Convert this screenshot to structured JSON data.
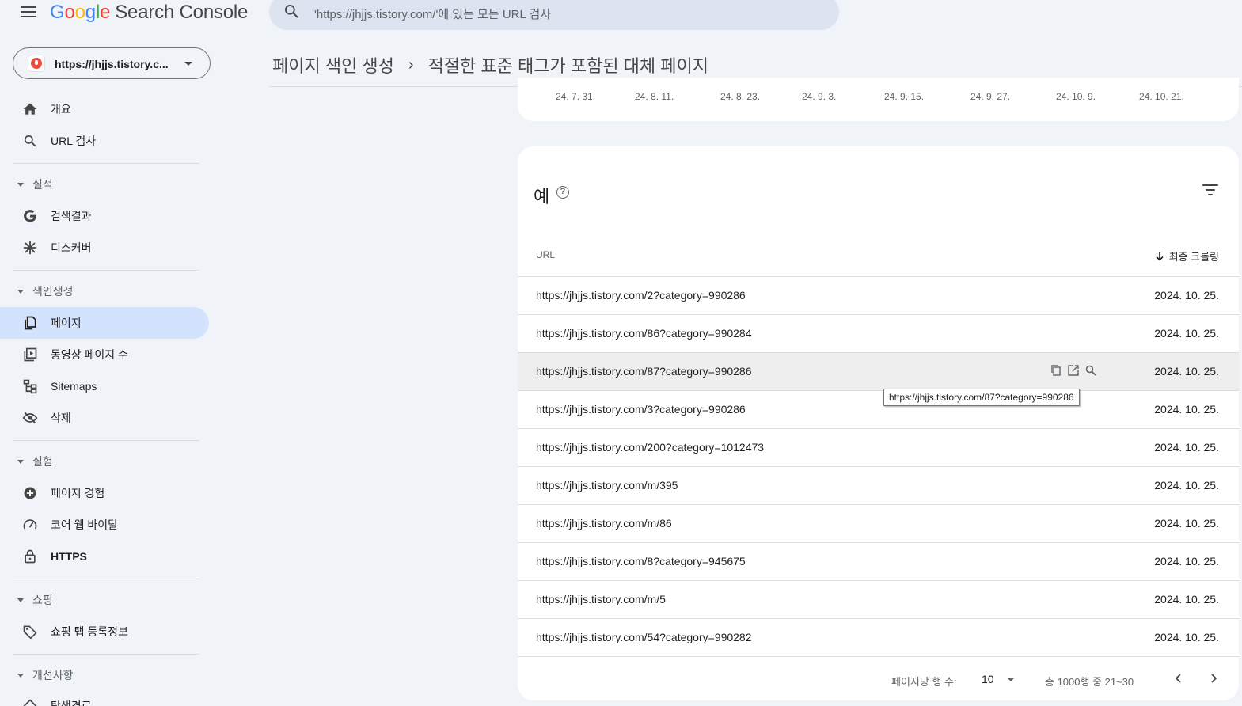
{
  "app": {
    "logo_google": [
      "G",
      "o",
      "o",
      "g",
      "l",
      "e"
    ],
    "logo_product": "Search Console"
  },
  "search": {
    "placeholder": "'https://jhjjs.tistory.com/'에 있는 모든 URL 검사"
  },
  "property": {
    "label": "https://jhjjs.tistory.c..."
  },
  "breadcrumb": {
    "parent": "페이지 색인 생성",
    "separator": "›",
    "current": "적절한 표준 태그가 포함된 대체 페이지"
  },
  "sidebar": {
    "top": [
      {
        "label": "개요",
        "icon": "home-icon"
      },
      {
        "label": "URL 검사",
        "icon": "search-icon"
      }
    ],
    "sections": [
      {
        "title": "실적",
        "items": [
          {
            "label": "검색결과",
            "icon": "google-g-icon"
          },
          {
            "label": "디스커버",
            "icon": "asterisk-icon"
          }
        ]
      },
      {
        "title": "색인생성",
        "items": [
          {
            "label": "페이지",
            "icon": "pages-icon",
            "active": true
          },
          {
            "label": "동영상 페이지 수",
            "icon": "video-pages-icon"
          },
          {
            "label": "Sitemaps",
            "icon": "sitemap-icon"
          },
          {
            "label": "삭제",
            "icon": "eye-off-icon"
          }
        ]
      },
      {
        "title": "실험",
        "items": [
          {
            "label": "페이지 경험",
            "icon": "plus-circle-icon"
          },
          {
            "label": "코어 웹 바이탈",
            "icon": "gauge-icon"
          },
          {
            "label": "HTTPS",
            "icon": "lock-icon"
          }
        ]
      },
      {
        "title": "쇼핑",
        "items": [
          {
            "label": "쇼핑 탭 등록정보",
            "icon": "tag-icon"
          }
        ]
      },
      {
        "title": "개선사항",
        "items": [
          {
            "label": "탐색경로",
            "icon": "breadcrumb-icon"
          }
        ]
      }
    ]
  },
  "chart_axis": {
    "ticks": [
      "24. 7. 31.",
      "24. 8. 11.",
      "24. 8. 23.",
      "24. 9. 3.",
      "24. 9. 15.",
      "24. 9. 27.",
      "24. 10. 9.",
      "24. 10. 21."
    ]
  },
  "examples": {
    "title": "예",
    "help_glyph": "?",
    "col_url": "URL",
    "col_crawl": "최종 크롤링",
    "rows": [
      {
        "url": "https://jhjjs.tistory.com/2?category=990286",
        "date": "2024. 10. 25."
      },
      {
        "url": "https://jhjjs.tistory.com/86?category=990284",
        "date": "2024. 10. 25."
      },
      {
        "url": "https://jhjjs.tistory.com/87?category=990286",
        "date": "2024. 10. 25.",
        "hover": true
      },
      {
        "url": "https://jhjjs.tistory.com/3?category=990286",
        "date": "2024. 10. 25."
      },
      {
        "url": "https://jhjjs.tistory.com/200?category=1012473",
        "date": "2024. 10. 25."
      },
      {
        "url": "https://jhjjs.tistory.com/m/395",
        "date": "2024. 10. 25."
      },
      {
        "url": "https://jhjjs.tistory.com/m/86",
        "date": "2024. 10. 25."
      },
      {
        "url": "https://jhjjs.tistory.com/8?category=945675",
        "date": "2024. 10. 25."
      },
      {
        "url": "https://jhjjs.tistory.com/m/5",
        "date": "2024. 10. 25."
      },
      {
        "url": "https://jhjjs.tistory.com/54?category=990282",
        "date": "2024. 10. 25."
      }
    ],
    "tooltip": "https://jhjjs.tistory.com/87?category=990286"
  },
  "pagination": {
    "rows_label": "페이지당 행 수:",
    "rows_value": "10",
    "range": "총 1000행 중 21~30"
  },
  "colors": {
    "active_nav": "#d3e3fd",
    "background": "#f0f4f9",
    "search_bg": "#dde3f0"
  }
}
